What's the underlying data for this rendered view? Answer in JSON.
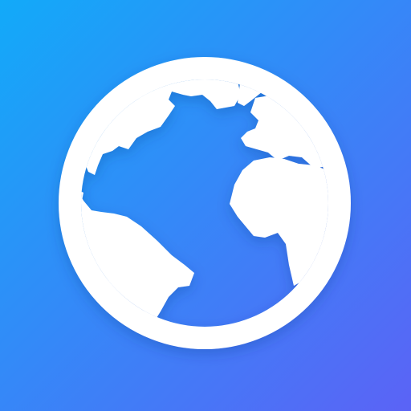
{
  "icon": {
    "name": "globe-icon",
    "colors": {
      "gradient_start": "#12aaf9",
      "gradient_end": "#5b63f6",
      "globe": "#ffffff"
    }
  }
}
